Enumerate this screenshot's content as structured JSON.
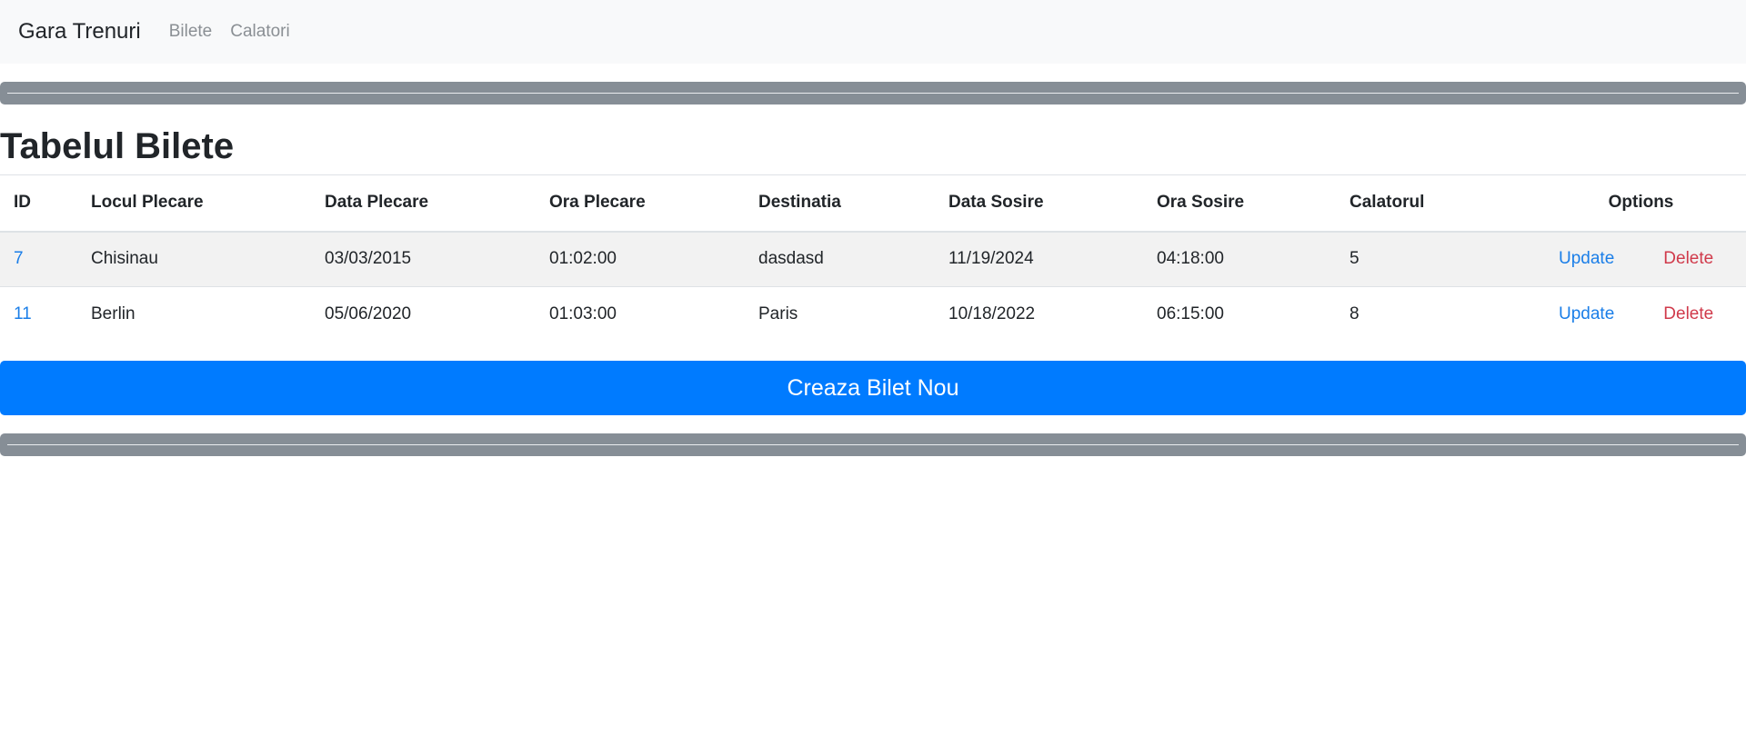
{
  "navbar": {
    "brand": "Gara Trenuri",
    "links": [
      "Bilete",
      "Calatori"
    ]
  },
  "page": {
    "title": "Tabelul Bilete"
  },
  "table": {
    "headers": [
      "ID",
      "Locul Plecare",
      "Data Plecare",
      "Ora Plecare",
      "Destinatia",
      "Data Sosire",
      "Ora Sosire",
      "Calatorul",
      "Options"
    ],
    "rows": [
      {
        "id": "7",
        "locul_plecare": "Chisinau",
        "data_plecare": "03/03/2015",
        "ora_plecare": "01:02:00",
        "destinatia": "dasdasd",
        "data_sosire": "11/19/2024",
        "ora_sosire": "04:18:00",
        "calatorul": "5",
        "update_label": "Update",
        "delete_label": "Delete"
      },
      {
        "id": "11",
        "locul_plecare": "Berlin",
        "data_plecare": "05/06/2020",
        "ora_plecare": "01:03:00",
        "destinatia": "Paris",
        "data_sosire": "10/18/2022",
        "ora_sosire": "06:15:00",
        "calatorul": "8",
        "update_label": "Update",
        "delete_label": "Delete"
      }
    ]
  },
  "actions": {
    "create_label": "Creaza Bilet Nou"
  },
  "colors": {
    "navbar_bg": "#f8f9fa",
    "separator": "#868e96",
    "primary": "#007bff",
    "link": "#1a7ee8",
    "danger": "#d03a4b",
    "stripe": "#f2f2f2"
  }
}
